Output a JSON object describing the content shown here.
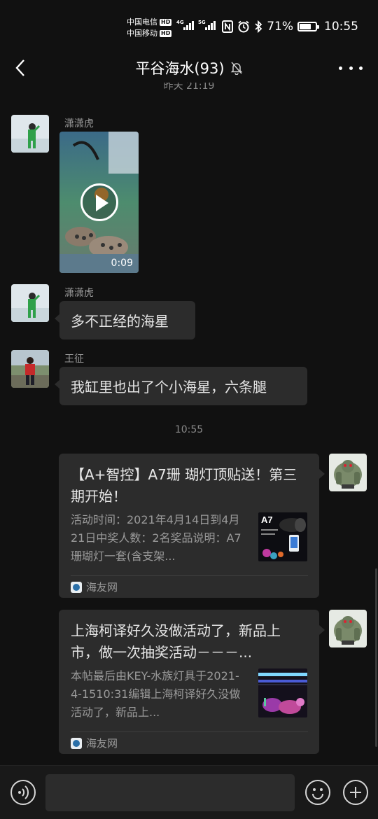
{
  "status_bar": {
    "carrier_1": "中国电信",
    "carrier_2": "中国移动",
    "hd_label": "HD",
    "net_1": "4G",
    "net_2": "5G",
    "battery_percent": "71%",
    "battery_level": 0.71,
    "time": "10:55"
  },
  "nav": {
    "title": "平谷海水(93)",
    "muted_icon": "bell-off-icon",
    "back_icon": "chevron-left-icon",
    "more_icon": "more-dots-icon"
  },
  "timestamps": {
    "top_partial": "昨天 21:19",
    "mid": "10:55"
  },
  "messages": [
    {
      "sender": "潇潇虎",
      "type": "video",
      "duration": "0:09"
    },
    {
      "sender": "潇潇虎",
      "type": "text",
      "text": "多不正经的海星"
    },
    {
      "sender": "王征",
      "type": "text",
      "text": "我缸里也出了个小海星，六条腿"
    }
  ],
  "cards": [
    {
      "title": "【A+智控】A7珊 瑚灯顶贴送！第三期开始！",
      "description": "活动时间：2021年4月14日到4月21日中奖人数：2名奖品说明：A7珊瑚灯一套(含支架...",
      "thumb_label": "A7",
      "source": "海友网"
    },
    {
      "title": "上海柯译好久没做活动了，新品上市，做一次抽奖活动－－－...",
      "description": "本帖最后由KEY-水族灯具于2021-4-1510:31编辑上海柯译好久没做活动了，新品上...",
      "source": "海友网"
    }
  ],
  "input_bar": {
    "voice_icon": "voice-icon",
    "emoji_icon": "emoji-icon",
    "add_icon": "plus-circle-icon",
    "value": ""
  }
}
